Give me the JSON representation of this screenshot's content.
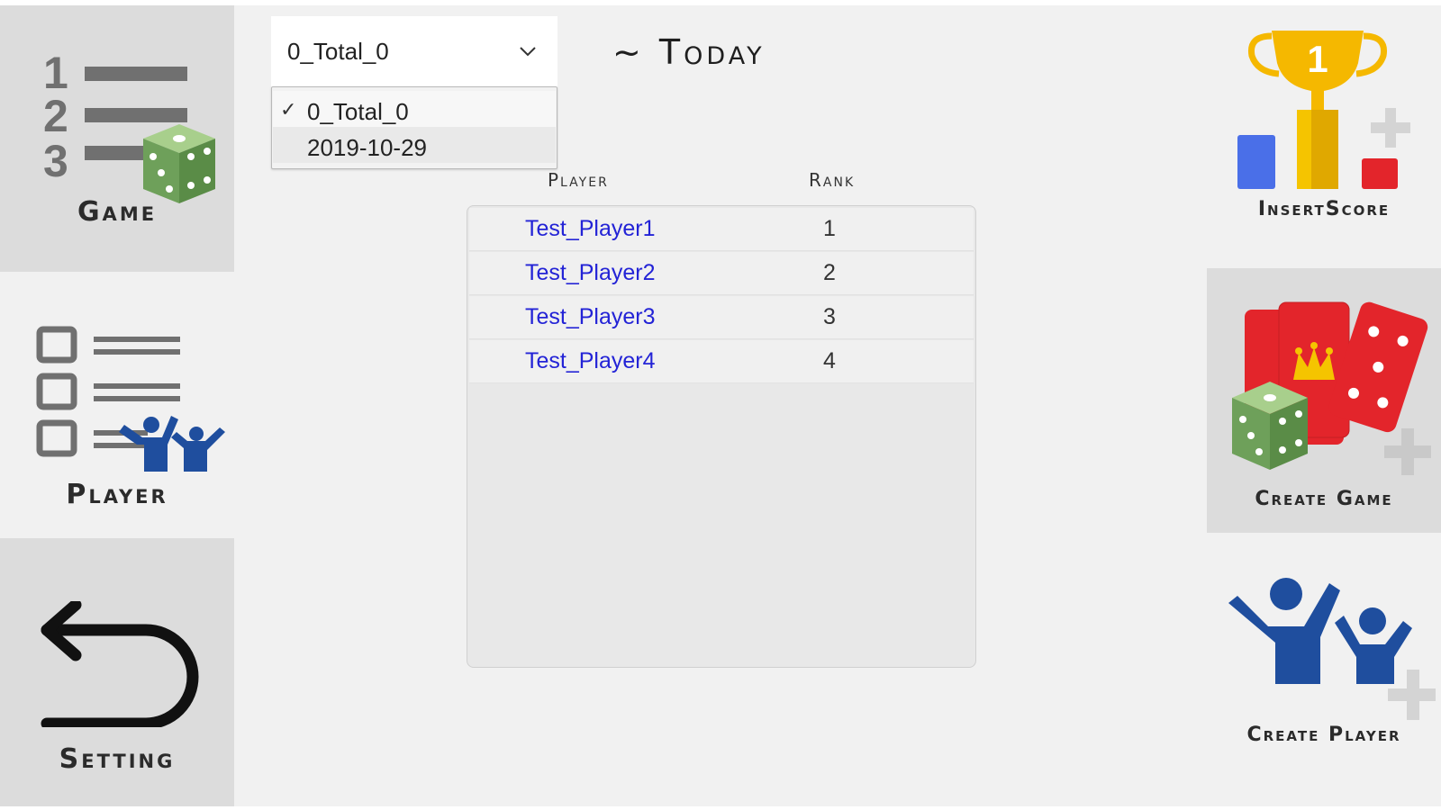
{
  "nav": {
    "game_label": "Game",
    "player_label": "Player",
    "setting_label": "Setting"
  },
  "actions": {
    "insert_score_label": "InsertScore",
    "create_game_label": "Create Game",
    "create_player_label": "Create Player"
  },
  "filter": {
    "selected": "0_Total_0",
    "options": [
      {
        "label": "0_Total_0",
        "checked": true
      },
      {
        "label": "2019-10-29",
        "checked": false
      }
    ]
  },
  "period_label": "~ Today",
  "table": {
    "columns": [
      "Player",
      "Rank"
    ],
    "rows": [
      {
        "player": "Test_Player1",
        "rank": "1"
      },
      {
        "player": "Test_Player2",
        "rank": "2"
      },
      {
        "player": "Test_Player3",
        "rank": "3"
      },
      {
        "player": "Test_Player4",
        "rank": "4"
      }
    ]
  },
  "icons": {
    "game": "ranked-list-dice-icon",
    "player": "checklist-people-icon",
    "setting": "back-arrow-icon",
    "insert_score": "trophy-podium-icon",
    "create_game": "cards-dice-plus-icon",
    "create_player": "people-plus-icon"
  },
  "colors": {
    "link": "#2323d6",
    "dice_green": "#6ea05a",
    "people_blue": "#1f4e9e",
    "card_red": "#e3252b",
    "trophy_gold": "#f5b800",
    "podium_blue": "#4a6fe8"
  }
}
